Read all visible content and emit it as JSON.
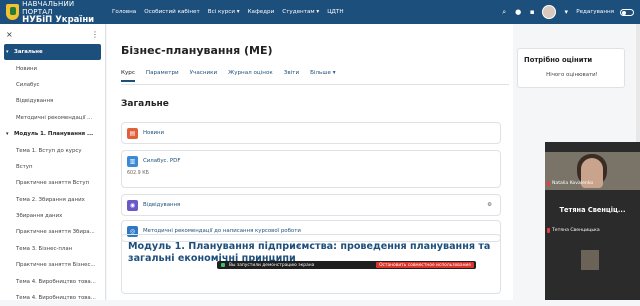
{
  "header": {
    "logo_line1": "НАВЧАЛЬНИЙ ПОРТАЛ",
    "logo_line2": "НУБіП України",
    "nav": [
      "Головна",
      "Особистий кабінет",
      "Всі курси ▾",
      "Кафедри",
      "Студентам ▾",
      "ЦДТН"
    ],
    "edit_mode_label": "Редагування"
  },
  "sidebar": {
    "close_glyph": "×",
    "more_glyph": "⋮",
    "items": [
      {
        "label": "Загальне",
        "type": "section",
        "active": true
      },
      {
        "label": "Новини",
        "type": "item"
      },
      {
        "label": "Силабус",
        "type": "item"
      },
      {
        "label": "Відвідування",
        "type": "item"
      },
      {
        "label": "Методичні рекомендації ...",
        "type": "item"
      },
      {
        "label": "Модуль 1. Планування ...",
        "type": "section"
      },
      {
        "label": "Тема 1. Вступ до курсу",
        "type": "item"
      },
      {
        "label": "Вступ",
        "type": "item"
      },
      {
        "label": "Практичне заняття Вступ",
        "type": "item"
      },
      {
        "label": "Тема 2. Збирання даних",
        "type": "item"
      },
      {
        "label": "Збирання даних",
        "type": "item"
      },
      {
        "label": "Практичне заняття Збира...",
        "type": "item"
      },
      {
        "label": "Тема 3. Бізнес-план",
        "type": "item"
      },
      {
        "label": "Практичне заняття Бізнес...",
        "type": "item"
      },
      {
        "label": "Тема 4. Виробництво това...",
        "type": "item"
      },
      {
        "label": "Тема 4. Виробництво това...",
        "type": "item"
      }
    ]
  },
  "main": {
    "title": "Бізнес-планування (МЕ)",
    "tabs": [
      "Курс",
      "Параметри",
      "Учасники",
      "Журнал оцінок",
      "Звіти",
      "Більше ▾"
    ],
    "section_title": "Загальне",
    "activities": [
      {
        "label": "Новини",
        "icon": "forum-icon",
        "color": "#e0603a"
      },
      {
        "label": "Силабус. PDF",
        "icon": "pdf-file-icon",
        "color": "#3a8ad6",
        "meta": "602.9 КБ"
      },
      {
        "label": "Відвідування",
        "icon": "attendance-icon",
        "color": "#6a57c9"
      },
      {
        "label": "Методичні рекомендації до написання курсової роботи",
        "icon": "url-icon",
        "color": "#2f79c4"
      }
    ],
    "module_title": "Модуль 1. Планування підприємства: проведення планування та загальні економічні принципи"
  },
  "right_block": {
    "title": "Потрібно оцінити",
    "text": "Нічого оцінювати!"
  },
  "video": {
    "cam_name": "Natalia Kovalenko",
    "speaker_name": "Тетяна Свенціц...",
    "speaker_small": "Тетяна Свенцицька"
  },
  "share_bar": {
    "text": "Вы запустили демонстрацию экрана",
    "stop_label": "Остановить совместное использование"
  }
}
